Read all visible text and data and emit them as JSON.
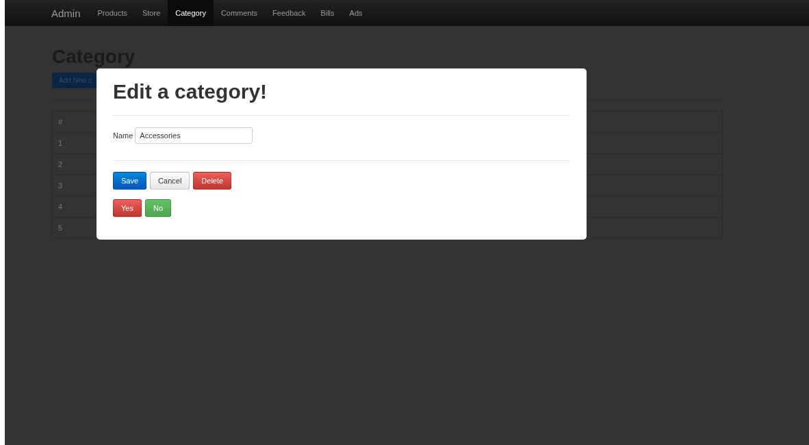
{
  "navbar": {
    "brand": "Admin",
    "items": [
      {
        "label": "Products",
        "selected": false
      },
      {
        "label": "Store",
        "selected": false
      },
      {
        "label": "Category",
        "selected": true
      },
      {
        "label": "Comments",
        "selected": false
      },
      {
        "label": "Feedback",
        "selected": false
      },
      {
        "label": "Bills",
        "selected": false
      },
      {
        "label": "Ads",
        "selected": false
      }
    ]
  },
  "page": {
    "title": "Category",
    "add_button": "Add New c",
    "table": {
      "columns": [
        "#"
      ],
      "rows": [
        "1",
        "2",
        "3",
        "4",
        "5"
      ]
    }
  },
  "modal": {
    "title": "Edit a category!",
    "field": {
      "label": "Name",
      "value": "Accessories"
    },
    "buttons": [
      {
        "label": "Save",
        "kind": "primary"
      },
      {
        "label": "Cancel",
        "kind": "default"
      },
      {
        "label": "Delete",
        "kind": "danger"
      }
    ],
    "confirm_buttons": [
      {
        "label": "Yes",
        "kind": "danger"
      },
      {
        "label": "No",
        "kind": "success"
      }
    ]
  }
}
